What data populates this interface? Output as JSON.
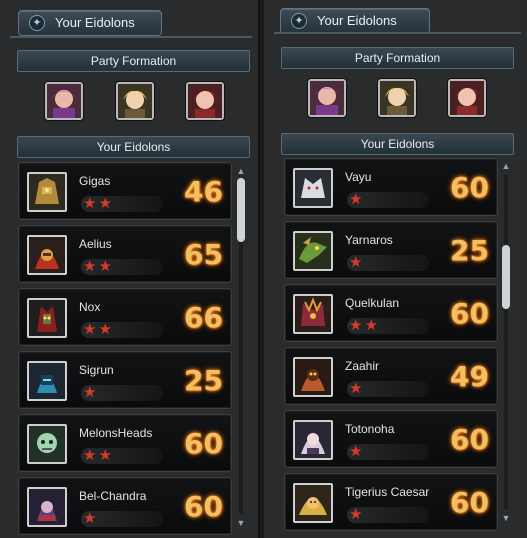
{
  "left": {
    "title": "Your Eidolons",
    "party_label": "Party Formation",
    "list_label": "Your Eidolons",
    "eidolons": [
      {
        "name": "Gigas",
        "stars": "★★",
        "level": "46"
      },
      {
        "name": "Aelius",
        "stars": "★★",
        "level": "65"
      },
      {
        "name": "Nox",
        "stars": "★★",
        "level": "66"
      },
      {
        "name": "Sigrun",
        "stars": "★",
        "level": "25"
      },
      {
        "name": "MelonsHeads",
        "stars": "★★",
        "level": "60"
      },
      {
        "name": "Bel-Chandra",
        "stars": "★",
        "level": "60"
      }
    ]
  },
  "right": {
    "title": "Your Eidolons",
    "party_label": "Party Formation",
    "list_label": "Your Eidolons",
    "eidolons": [
      {
        "name": "Vayu",
        "stars": "★",
        "level": "60"
      },
      {
        "name": "Yarnaros",
        "stars": "★",
        "level": "25"
      },
      {
        "name": "Quelkulan",
        "stars": "★★",
        "level": "60"
      },
      {
        "name": "Zaahir",
        "stars": "★",
        "level": "49"
      },
      {
        "name": "Totonoha",
        "stars": "★",
        "level": "60"
      },
      {
        "name": "Tigerius Caesar",
        "stars": "★",
        "level": "60"
      }
    ]
  },
  "icons": {
    "title_badge": "star-icon",
    "scroll_up": "▲",
    "scroll_down": "▼"
  },
  "colors": {
    "level_text": "#f2c063",
    "star_red": "#d63a2a"
  }
}
